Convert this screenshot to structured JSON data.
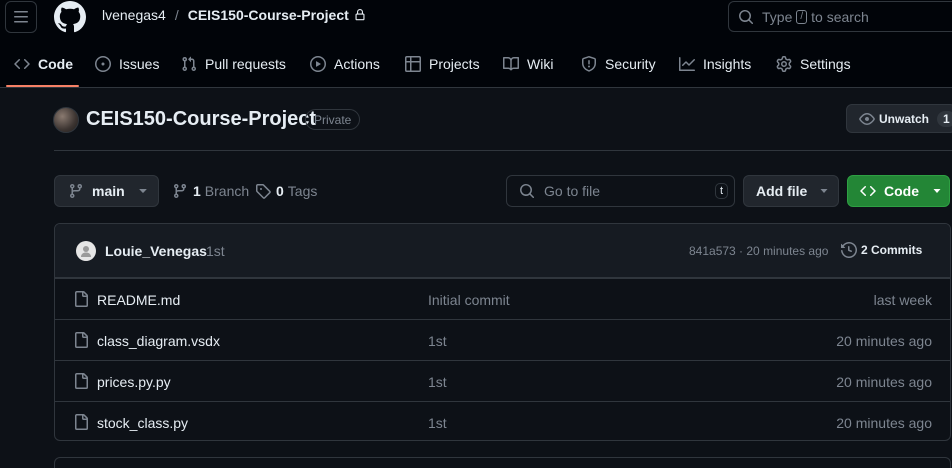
{
  "header": {
    "owner": "lvenegas4",
    "separator": "/",
    "repo": "CEIS150-Course-Project",
    "search_prefix": "Type",
    "search_key": "/",
    "search_suffix": "to search"
  },
  "tabs": [
    {
      "label": "Code",
      "icon": "code-icon",
      "active": true
    },
    {
      "label": "Issues",
      "icon": "issue-icon"
    },
    {
      "label": "Pull requests",
      "icon": "pull-request-icon"
    },
    {
      "label": "Actions",
      "icon": "play-icon"
    },
    {
      "label": "Projects",
      "icon": "table-icon"
    },
    {
      "label": "Wiki",
      "icon": "book-icon"
    },
    {
      "label": "Security",
      "icon": "shield-icon"
    },
    {
      "label": "Insights",
      "icon": "graph-icon"
    },
    {
      "label": "Settings",
      "icon": "gear-icon"
    }
  ],
  "repo_header": {
    "title": "CEIS150-Course-Project",
    "visibility": "Private",
    "unwatch_label": "Unwatch",
    "watch_count": "1"
  },
  "toolbar": {
    "branch": "main",
    "branch_count": "1",
    "branch_label": "Branch",
    "tag_count": "0",
    "tag_label": "Tags",
    "goto_placeholder": "Go to file",
    "goto_key": "t",
    "add_file_label": "Add file",
    "code_label": "Code"
  },
  "latest_commit": {
    "author": "Louie_Venegas",
    "message": "1st",
    "meta": "841a573 · 20 minutes ago",
    "commits_label": "2 Commits"
  },
  "files": [
    {
      "name": "README.md",
      "message": "Initial commit",
      "age": "last week"
    },
    {
      "name": "class_diagram.vsdx",
      "message": "1st",
      "age": "20 minutes ago"
    },
    {
      "name": "prices.py.py",
      "message": "1st",
      "age": "20 minutes ago"
    },
    {
      "name": "stock_class.py",
      "message": "1st",
      "age": "20 minutes ago"
    }
  ],
  "colors": {
    "accent_underline": "#f78166",
    "code_button": "#238636",
    "background": "#0d1117"
  }
}
